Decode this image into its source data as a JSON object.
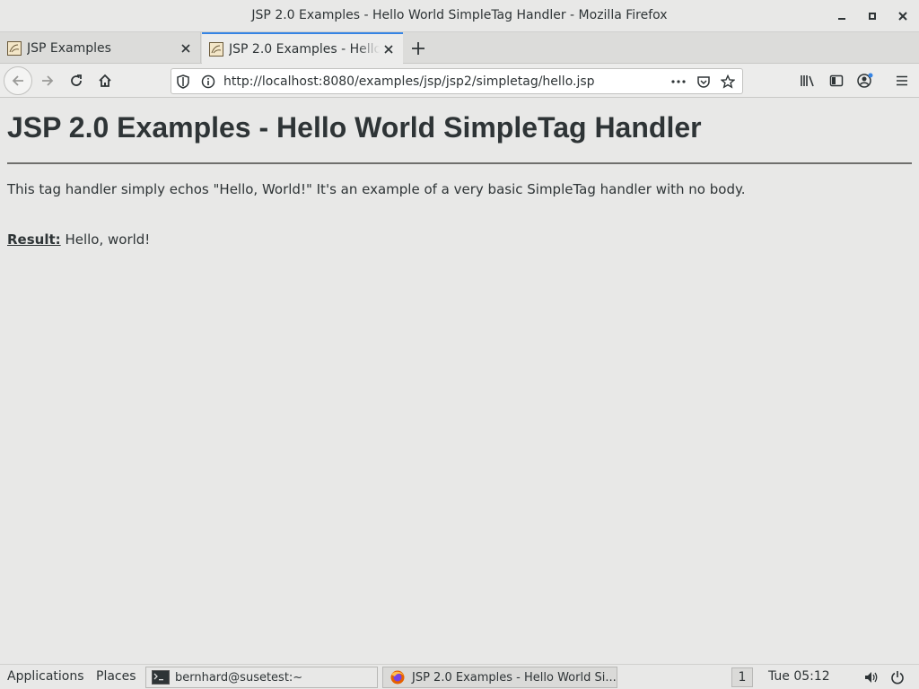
{
  "window": {
    "title": "JSP 2.0 Examples - Hello World SimpleTag Handler - Mozilla Firefox"
  },
  "tabs": [
    {
      "label": "JSP Examples",
      "active": false
    },
    {
      "label": "JSP 2.0 Examples - Hello World SimpleTag Handler",
      "active": true
    }
  ],
  "navbar": {
    "url": "http://localhost:8080/examples/jsp/jsp2/simpletag/hello.jsp"
  },
  "page": {
    "heading": "JSP 2.0 Examples - Hello World SimpleTag Handler",
    "description": "This tag handler simply echos \"Hello, World!\" It's an example of a very basic SimpleTag handler with no body.",
    "result_label": "Result:",
    "result_value": "Hello, world!"
  },
  "taskbar": {
    "applications": "Applications",
    "places": "Places",
    "windows": [
      {
        "label": "bernhard@susetest:~",
        "icon": "terminal-icon"
      },
      {
        "label": "JSP 2.0 Examples - Hello World Si...",
        "icon": "firefox-icon"
      }
    ],
    "workspace": "1",
    "clock": "Tue 05:12"
  },
  "colors": {
    "accent": "#3584e4",
    "background": "#e8e8e7",
    "text": "#2e3436"
  }
}
